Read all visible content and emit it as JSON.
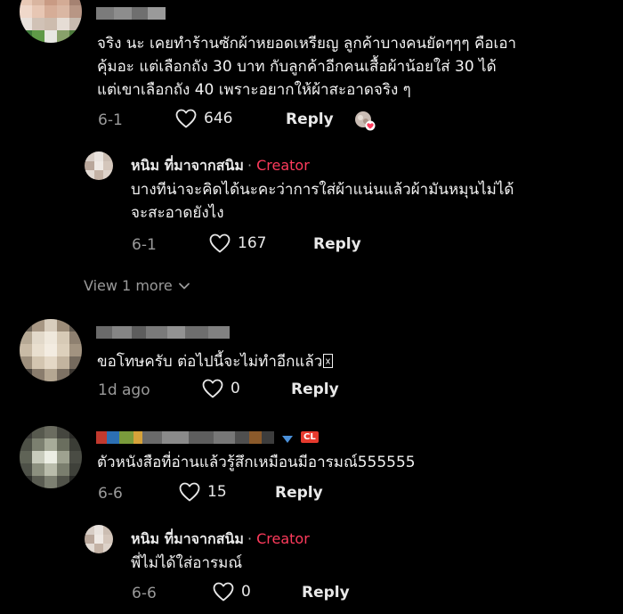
{
  "comments": [
    {
      "id": "c1",
      "text_lines": [
        "จริง นะ เคยทำร้านซักผ้าหยอดเหรียญ ลูกค้าบางคนยัดๆๆๆ คือเอา",
        "คุ้มอะ แต่เลือกถัง 30 บาท กับลูกค้าอีกคนเสื้อผ้าน้อยใส่ 30 ได้",
        "แต่เขาเลือกถัง 40 เพราะอยากให้ผ้าสะอาดจริง ๆ"
      ],
      "date": "6-1",
      "likes": "646",
      "reply_label": "Reply",
      "creator_liked_icon": "creator-liked-heart-avatar",
      "replies": [
        {
          "username": "หนิม ที่มาจากสนิม",
          "separator": "·",
          "creator_label": "Creator",
          "text_lines": [
            "บางทีน่าจะคิดได้นะคะว่าการใส่ผ้าแน่นแล้วผ้ามันหมุนไม่ได้",
            "จะสะอาดยังไง"
          ],
          "date": "6-1",
          "likes": "167",
          "reply_label": "Reply"
        }
      ],
      "view_more_label": "View 1 more"
    },
    {
      "id": "c2",
      "text": "ขอโทษครับ ต่อไปนี้จะไม่ทำอีกแล้ว",
      "date": "1d ago",
      "likes": "0",
      "reply_label": "Reply"
    },
    {
      "id": "c3",
      "badge": "CL",
      "text": "ตัวหนังสือที่อ่านแล้วรู้สึกเหมือนมีอารมณ์555555",
      "date": "6-6",
      "likes": "15",
      "reply_label": "Reply",
      "replies": [
        {
          "username": "หนิม ที่มาจากสนิม",
          "separator": "·",
          "creator_label": "Creator",
          "text": "พี่ไม่ได้ใส่อารมณ์",
          "date": "6-6",
          "likes": "0",
          "reply_label": "Reply"
        }
      ]
    }
  ],
  "colors": {
    "background": "#000000",
    "text_primary": "#f2f2f2",
    "text_secondary": "#9a9a9a",
    "creator_accent": "#ff3b5c",
    "badge_red": "#e63a2e",
    "heart_outline": "#e8e8e8"
  }
}
